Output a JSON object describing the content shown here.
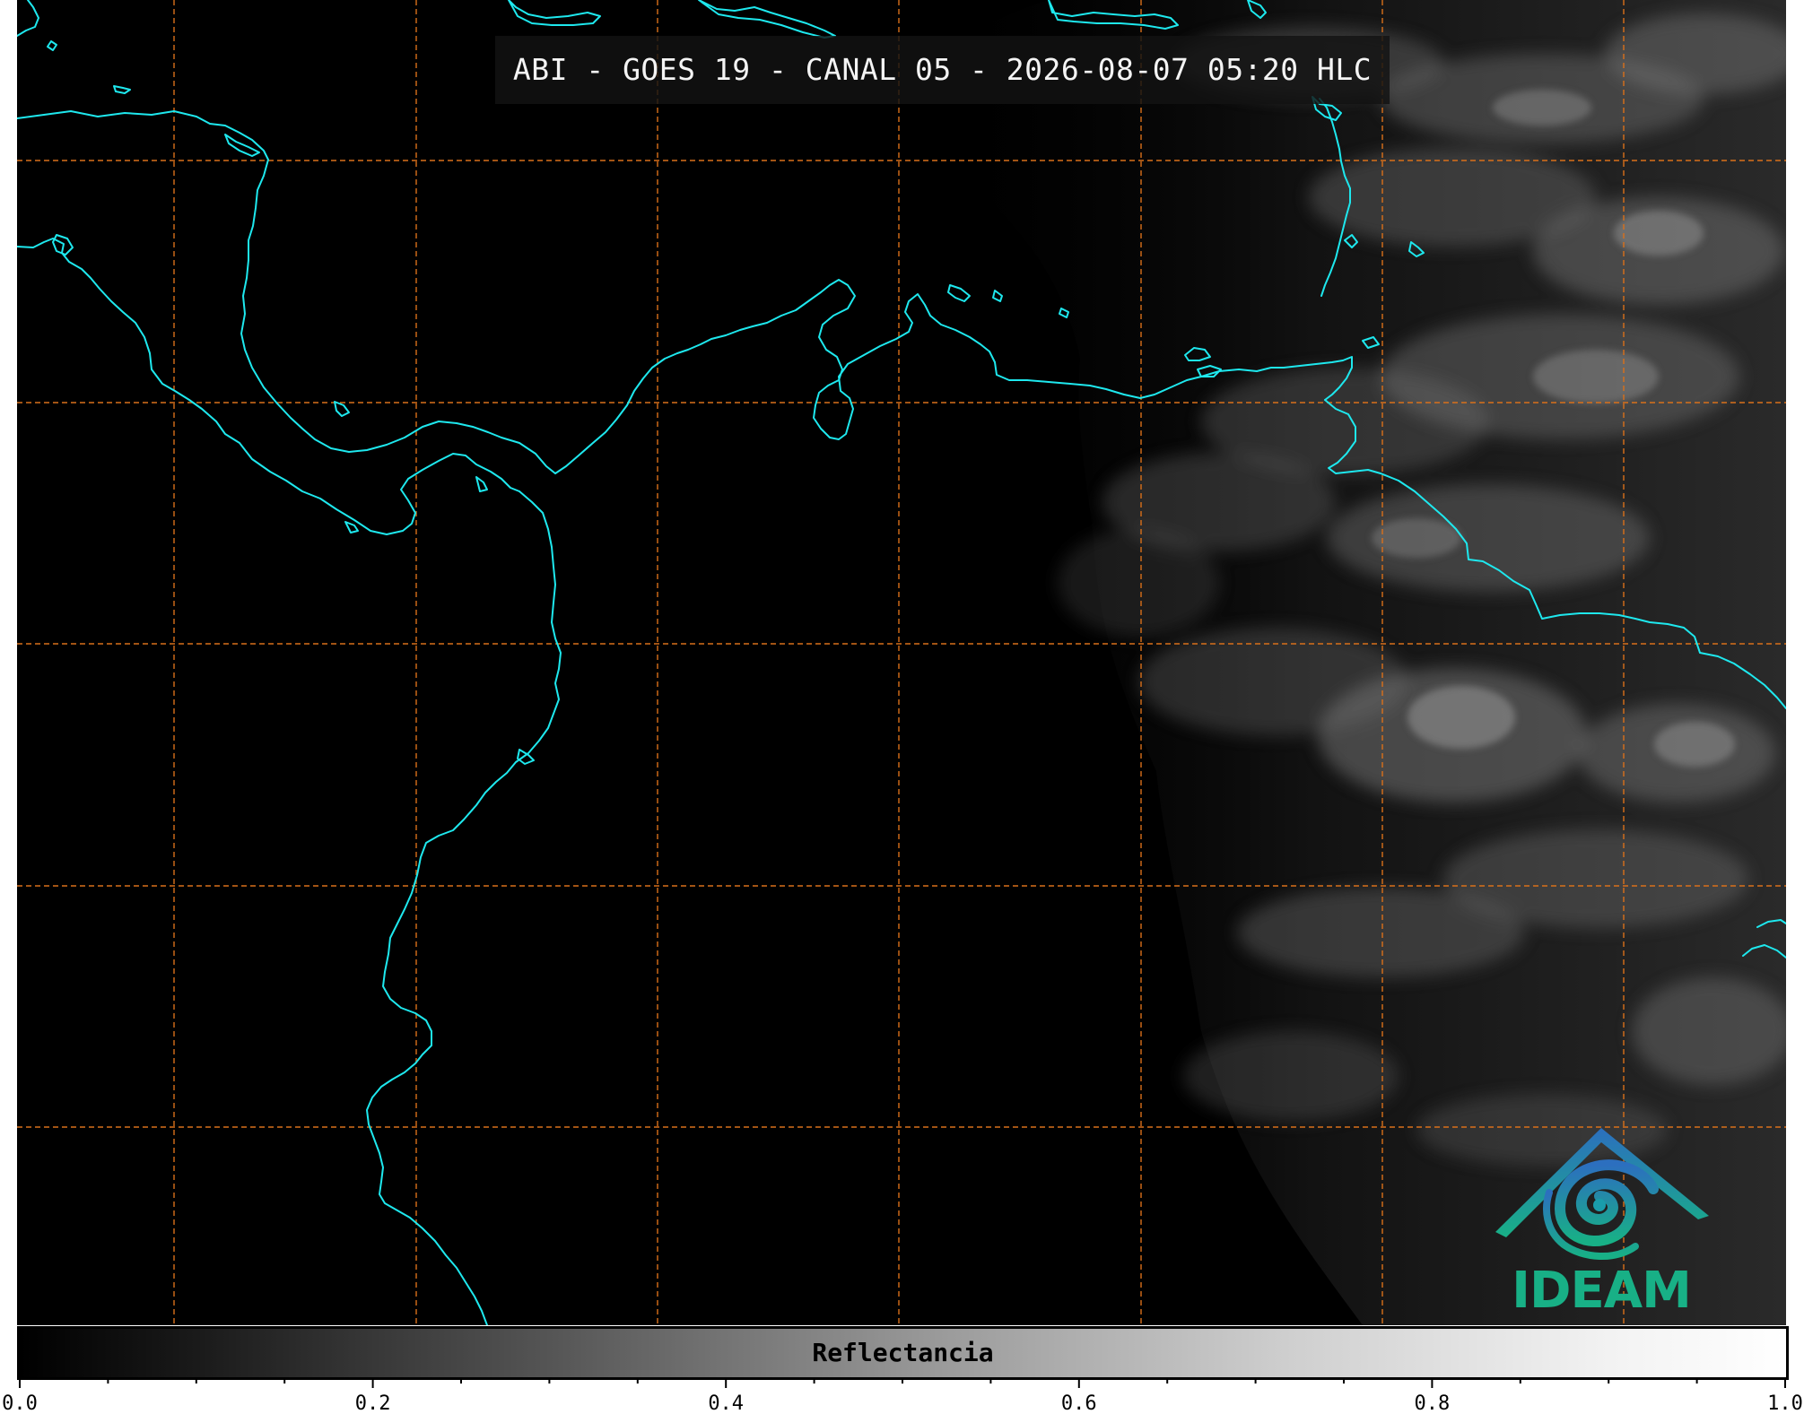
{
  "map": {
    "title": "ABI - GOES 19 - CANAL 05 - 2026-08-07 05:20 HLC",
    "background_color": "#000000",
    "coastline_color": "#1ee8ee",
    "graticule_color": "#d9701a",
    "cloud_color": "#8a8a8a"
  },
  "logo": {
    "text": "IDEAM",
    "text_color": "#18b086",
    "roof_color": "#2c6fbf",
    "swirl_color": "#1aa79a"
  },
  "colorbar": {
    "label": "Reflectancia",
    "min": 0.0,
    "max": 1.0,
    "ticks": [
      "0.0",
      "0.2",
      "0.4",
      "0.6",
      "0.8",
      "1.0"
    ]
  }
}
